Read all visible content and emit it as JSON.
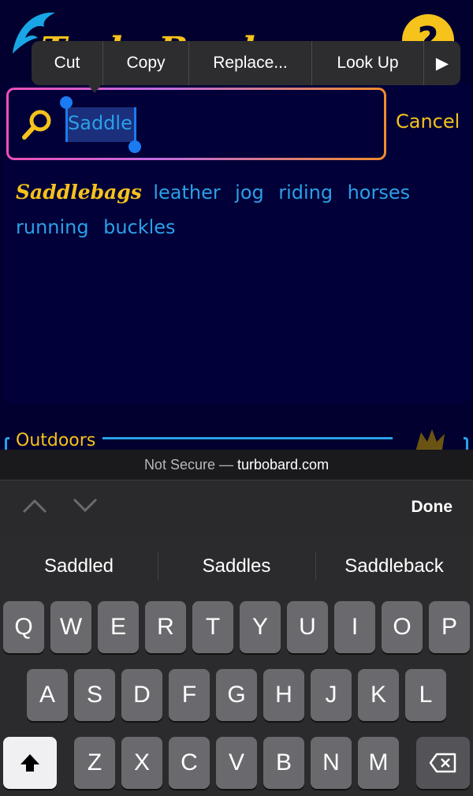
{
  "header": {
    "logo_text": "TurboBard",
    "help_icon": "?"
  },
  "edit_menu": {
    "items": [
      "Cut",
      "Copy",
      "Replace...",
      "Look Up",
      "▶"
    ]
  },
  "search": {
    "value": "Saddle",
    "cancel_label": "Cancel"
  },
  "suggestions": {
    "main": "Saddlebags",
    "words": [
      "leather",
      "jog",
      "riding",
      "horses",
      "running",
      "buckles"
    ]
  },
  "section": {
    "label": "Outdoors"
  },
  "browser": {
    "security": "Not Secure —",
    "domain": "turbobard.com"
  },
  "accessory": {
    "done_label": "Done"
  },
  "keyboard": {
    "predictions": [
      "Saddled",
      "Saddles",
      "Saddleback"
    ],
    "row1": [
      "Q",
      "W",
      "E",
      "R",
      "T",
      "Y",
      "U",
      "I",
      "O",
      "P"
    ],
    "row2": [
      "A",
      "S",
      "D",
      "F",
      "G",
      "H",
      "J",
      "K",
      "L"
    ],
    "row3": [
      "Z",
      "X",
      "C",
      "V",
      "B",
      "N",
      "M"
    ]
  },
  "colors": {
    "background": "#02002e",
    "accent_yellow": "#f6c21c",
    "accent_blue": "#2aa0e8"
  }
}
